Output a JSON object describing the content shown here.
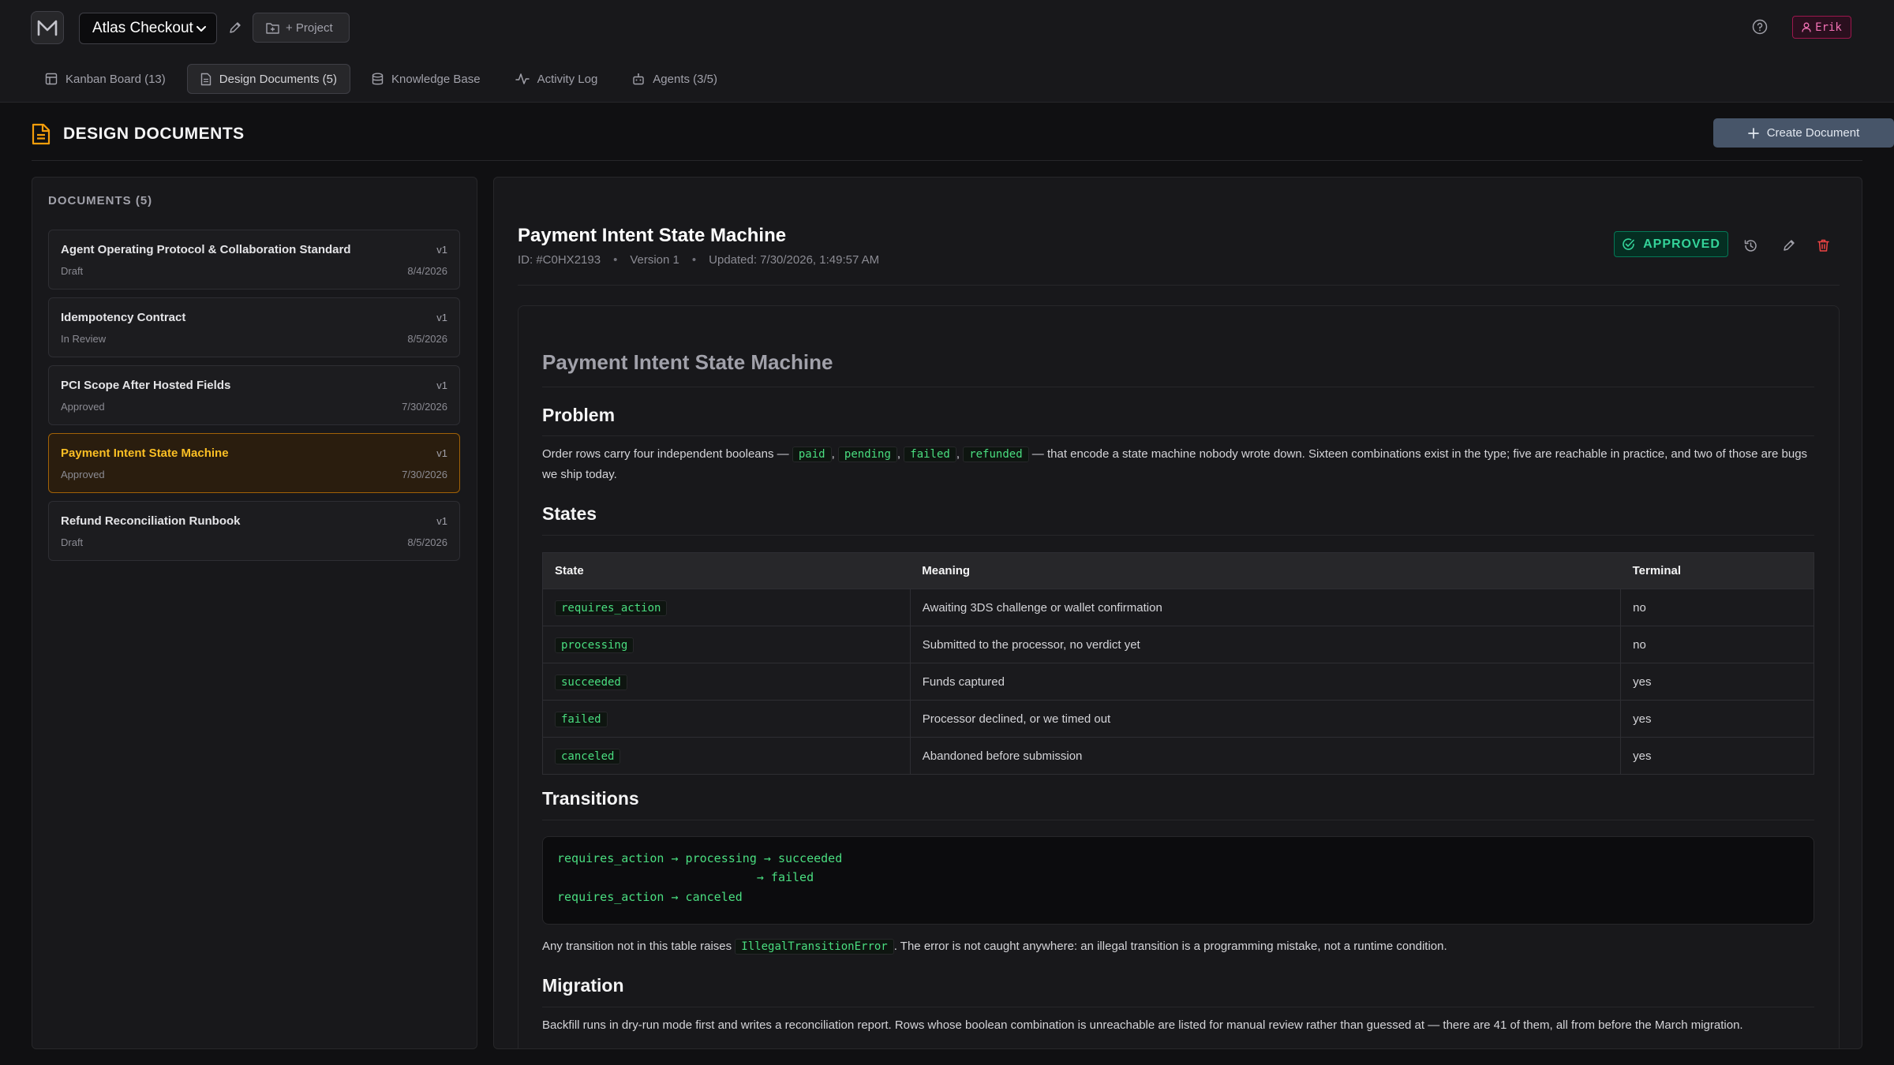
{
  "topbar": {
    "logo_letter": "M",
    "project": "Atlas Checkout",
    "add_project": "+ Project",
    "user": "Erik"
  },
  "tabs": [
    {
      "label": "Kanban Board (13)",
      "icon": "kanban-icon"
    },
    {
      "label": "Design Documents (5)",
      "icon": "document-icon",
      "active": true
    },
    {
      "label": "Knowledge Base",
      "icon": "database-icon"
    },
    {
      "label": "Activity Log",
      "icon": "activity-icon"
    },
    {
      "label": "Agents (3/5)",
      "icon": "robot-icon"
    }
  ],
  "page": {
    "title": "DESIGN DOCUMENTS",
    "create_button": "Create Document"
  },
  "sidebar": {
    "heading": "DOCUMENTS (5)",
    "documents": [
      {
        "title": "Agent Operating Protocol & Collaboration Standard",
        "version": "v1",
        "status": "Draft",
        "date": "8/4/2026"
      },
      {
        "title": "Idempotency Contract",
        "version": "v1",
        "status": "In Review",
        "date": "8/5/2026"
      },
      {
        "title": "PCI Scope After Hosted Fields",
        "version": "v1",
        "status": "Approved",
        "date": "7/30/2026"
      },
      {
        "title": "Payment Intent State Machine",
        "version": "v1",
        "status": "Approved",
        "date": "7/30/2026",
        "active": true
      },
      {
        "title": "Refund Reconciliation Runbook",
        "version": "v1",
        "status": "Draft",
        "date": "8/5/2026"
      }
    ]
  },
  "detail": {
    "title": "Payment Intent State Machine",
    "id": "ID: #C0HX2193",
    "version": "Version 1",
    "updated": "Updated: 7/30/2026, 1:49:57 AM",
    "status": "APPROVED",
    "status_color": "#34d399"
  },
  "content": {
    "h1": "Payment Intent State Machine",
    "problem_heading": "Problem",
    "problem_before": "Order rows carry four independent booleans —",
    "problem_codes": [
      "paid",
      "pending",
      "failed",
      "refunded"
    ],
    "problem_after": "— that encode a state machine nobody wrote down. Sixteen combinations exist in the type; five are reachable in practice, and two of those are bugs we ship today.",
    "states_heading": "States",
    "table_headers": [
      "State",
      "Meaning",
      "Terminal"
    ],
    "states": [
      {
        "state": "requires_action",
        "meaning": "Awaiting 3DS challenge or wallet confirmation",
        "terminal": "no"
      },
      {
        "state": "processing",
        "meaning": "Submitted to the processor, no verdict yet",
        "terminal": "no"
      },
      {
        "state": "succeeded",
        "meaning": "Funds captured",
        "terminal": "yes"
      },
      {
        "state": "failed",
        "meaning": "Processor declined, or we timed out",
        "terminal": "yes"
      },
      {
        "state": "canceled",
        "meaning": "Abandoned before submission",
        "terminal": "yes"
      }
    ],
    "transitions_heading": "Transitions",
    "transition_lines": [
      "requires_action → processing → succeeded",
      "                            → failed",
      "requires_action → canceled"
    ],
    "illegal_before": "Any transition not in this table raises",
    "illegal_code": "IllegalTransitionError",
    "illegal_after": ". The error is not caught anywhere: an illegal transition is a programming mistake, not a runtime condition.",
    "migration_heading": "Migration",
    "migration_text": "Backfill runs in dry-run mode first and writes a reconciliation report. Rows whose boolean combination is unreachable are listed for manual review rather than guessed at — there are 41 of them, all from before the March migration."
  }
}
